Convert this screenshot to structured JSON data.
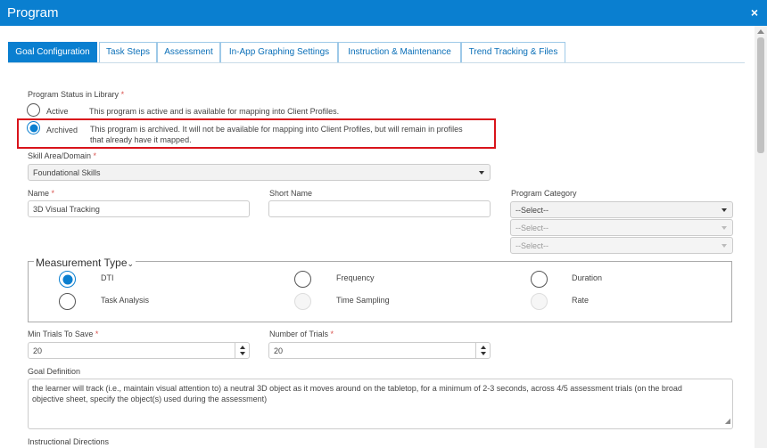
{
  "window": {
    "title": "Program",
    "close_icon": "×"
  },
  "tabs": [
    {
      "label": "Goal Configuration",
      "active": true
    },
    {
      "label": "Task Steps"
    },
    {
      "label": "Assessment"
    },
    {
      "label": "In-App Graphing Settings"
    },
    {
      "label": "Instruction & Maintenance"
    },
    {
      "label": "Trend Tracking & Files"
    }
  ],
  "status": {
    "label": "Program Status in Library",
    "required_mark": "*",
    "options": [
      {
        "label": "Active",
        "description": "This program is active and is available for mapping into Client Profiles.",
        "checked": false
      },
      {
        "label": "Archived",
        "description_line1": "This program is archived. It will not be available for mapping into Client Profiles, but will remain in profiles",
        "description_line2": "that already have it mapped.",
        "checked": true
      }
    ]
  },
  "skill_area": {
    "label": "Skill Area/Domain",
    "required_mark": "*",
    "value": "Foundational Skills"
  },
  "name": {
    "label": "Name",
    "required_mark": "*",
    "value": "3D Visual Tracking"
  },
  "short_name": {
    "label": "Short Name",
    "value": ""
  },
  "program_category": {
    "label": "Program Category",
    "value": "--Select--",
    "sub1": "--Select--",
    "sub2": "--Select--"
  },
  "measurement": {
    "legend": "Measurement Type",
    "chevron": "⌄",
    "options": [
      {
        "label": "DTI",
        "checked": true,
        "enabled": true
      },
      {
        "label": "Frequency",
        "checked": false,
        "enabled": true
      },
      {
        "label": "Duration",
        "checked": false,
        "enabled": true
      },
      {
        "label": "Task Analysis",
        "checked": false,
        "enabled": true
      },
      {
        "label": "Time Sampling",
        "checked": false,
        "enabled": false
      },
      {
        "label": "Rate",
        "checked": false,
        "enabled": false
      }
    ]
  },
  "min_trials": {
    "label": "Min Trials To Save",
    "required_mark": "*",
    "value": "20"
  },
  "num_trials": {
    "label": "Number of Trials",
    "required_mark": "*",
    "value": "20"
  },
  "goal_definition": {
    "label": "Goal Definition",
    "line1": "the learner will track (i.e., maintain visual attention to) a neutral 3D object as it moves around on the tabletop, for a minimum of 2-3 seconds, across 4/5 assessment trials (on the broad",
    "line2": "objective sheet, specify the object(s) used during the assessment)"
  },
  "instructional_directions": {
    "label": "Instructional Directions"
  },
  "colors": {
    "primary": "#0a7fd0",
    "highlight": "#d9141b",
    "required": "#d9534f"
  }
}
